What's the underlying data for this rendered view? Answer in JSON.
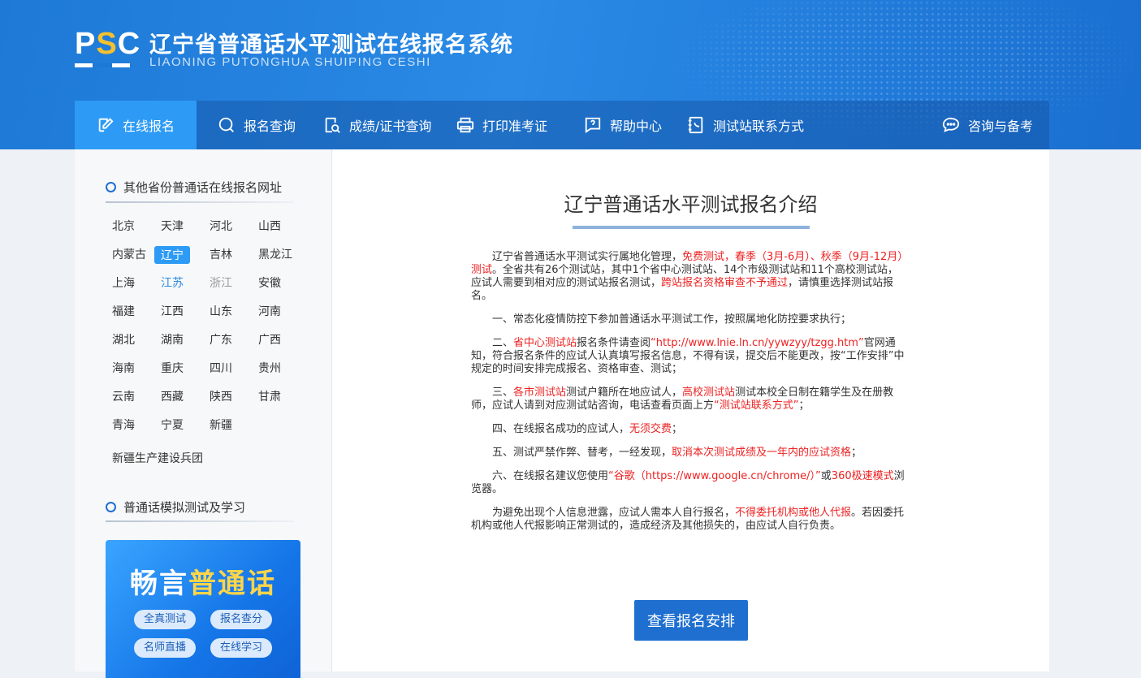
{
  "header": {
    "logo_text": "PSC",
    "title": "辽宁省普通话水平测试在线报名系统",
    "subtitle": "LIAONING PUTONGHUA SHUIPING CESHI"
  },
  "nav": {
    "items": [
      {
        "label": "在线报名",
        "icon": "edit-icon"
      },
      {
        "label": "报名查询",
        "icon": "search-icon"
      },
      {
        "label": "成绩/证书查询",
        "icon": "document-search-icon"
      },
      {
        "label": "打印准考证",
        "icon": "printer-icon"
      },
      {
        "label": "帮助中心",
        "icon": "help-icon"
      },
      {
        "label": "测试站联系方式",
        "icon": "phone-book-icon"
      },
      {
        "label": "咨询与备考",
        "icon": "chat-icon"
      }
    ]
  },
  "sidebar": {
    "provinces_title": "其他省份普通话在线报名网址",
    "provinces": [
      "北京",
      "天津",
      "河北",
      "山西",
      "内蒙古",
      "辽宁",
      "吉林",
      "黑龙江",
      "上海",
      "江苏",
      "浙江",
      "安徽",
      "福建",
      "江西",
      "山东",
      "河南",
      "湖北",
      "湖南",
      "广东",
      "广西",
      "海南",
      "重庆",
      "四川",
      "贵州",
      "云南",
      "西藏",
      "陕西",
      "甘肃",
      "青海",
      "宁夏",
      "新疆"
    ],
    "bingtuan": "新疆生产建设兵团",
    "practice_title": "普通话模拟测试及学习",
    "banner": {
      "title_part1": "畅言",
      "title_part2": "普通话",
      "pills": [
        "全真测试",
        "报名查分",
        "名师直播",
        "在线学习"
      ]
    }
  },
  "main": {
    "title": "辽宁普通话水平测试报名介绍",
    "p1": {
      "a": "辽宁省普通话水平测试实行属地化管理，",
      "b": "免费测试，春季（3月-6月）、秋季（9月-12月）测试",
      "c": "。全省共有26个测试站，其中1个省中心测试站、14个市级测试站和11个高校测试站，应试人需要到相对应的测试站报名测试，",
      "d": "跨站报名资格审查不予通过",
      "e": "，请慎重选择测试站报名。"
    },
    "p2": "一、常态化疫情防控下参加普通话水平测试工作，按照属地化防控要求执行；",
    "p3": {
      "a": "二、",
      "b": "省中心测试站",
      "c": "报名条件请查阅",
      "d": "“http://www.lnie.ln.cn/yywzyy/tzgg.htm”",
      "e": "官网通知，符合报名条件的应试人认真填写报名信息，不得有误，提交后不能更改，按“工作安排”中规定的时间安排完成报名、资格审查、测试；"
    },
    "p4": {
      "a": "三、",
      "b": "各市测试站",
      "c": "测试户籍所在地应试人，",
      "d": "高校测试站",
      "e": "测试本校全日制在籍学生及在册教师，应试人请到对应测试站咨询，电话查看页面上方",
      "f": "“测试站联系方式”",
      "g": "；"
    },
    "p5": {
      "a": "四、在线报名成功的应试人，",
      "b": "无须交费",
      "c": "；"
    },
    "p6": {
      "a": "五、测试严禁作弊、替考，一经发现，",
      "b": "取消本次测试成绩及一年内的应试资格",
      "c": "；"
    },
    "p7": {
      "a": "六、在线报名建议您使用",
      "b": "“谷歌（https://www.google.cn/chrome/）”",
      "c": "或",
      "d": "360极速模式",
      "e": "浏览器。"
    },
    "p8": {
      "a": "为避免出现个人信息泄露，应试人需本人自行报名，",
      "b": "不得委托机构或他人代报",
      "c": "。若因委托机构或他人代报影响正常测试的，造成经济及其他损失的，由应试人自行负责。"
    },
    "button_label": "查看报名安排"
  },
  "colors": {
    "brand": "#1e79d6",
    "nav_active": "#2d9bf5",
    "highlight": "#e22222",
    "logo_accent": "#f5c12e"
  }
}
